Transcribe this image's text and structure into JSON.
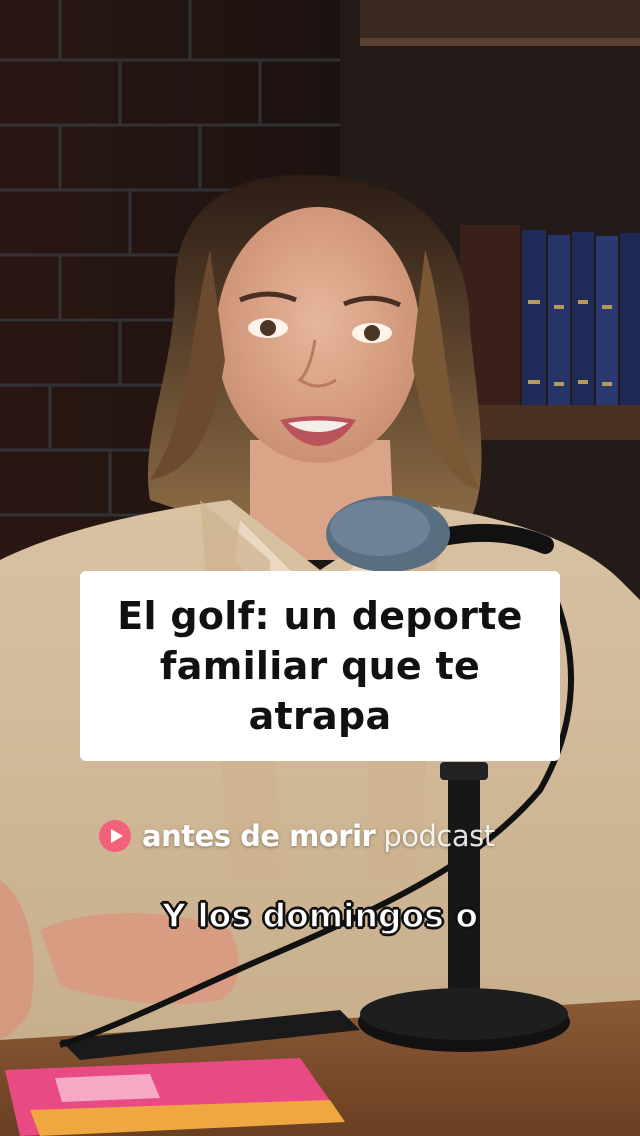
{
  "overlay": {
    "title": "El golf: un deporte familiar que te atrapa",
    "brand": {
      "name": "antes de morir",
      "suffix": "podcast",
      "icon": "play-icon",
      "accent_color": "#f2607a"
    },
    "caption": "Y los domingos o"
  }
}
